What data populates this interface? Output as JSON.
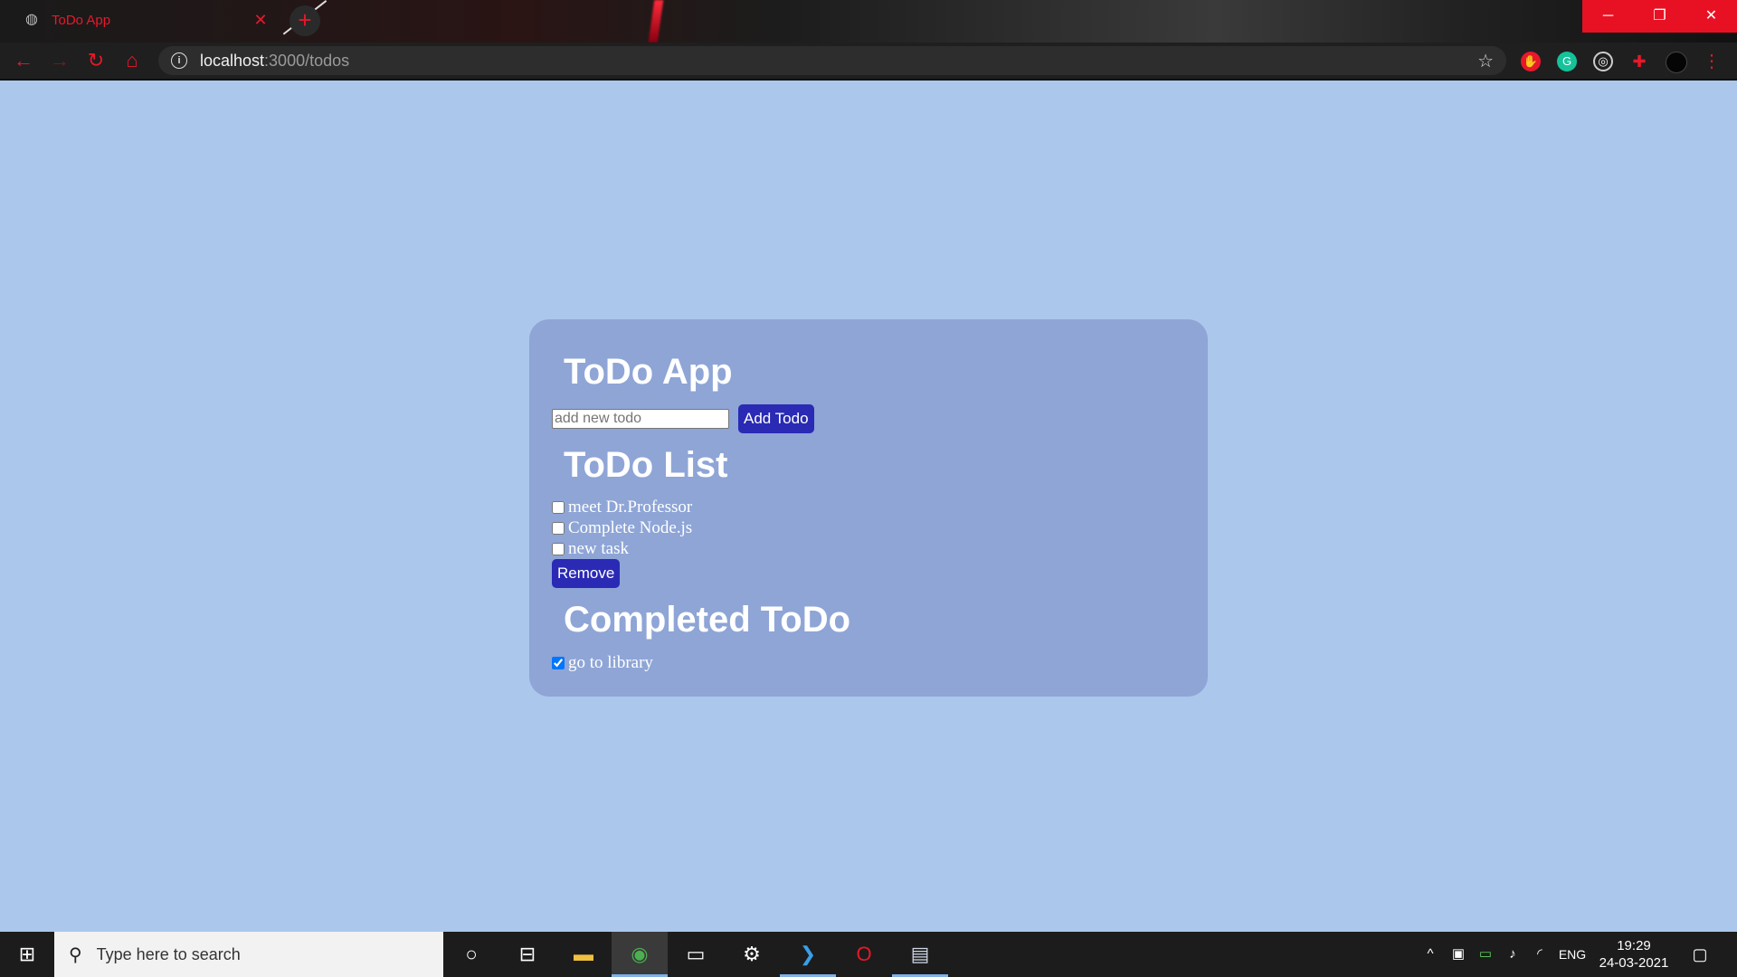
{
  "browser": {
    "tab_title": "ToDo App",
    "tab_close": "✕",
    "new_tab": "+",
    "url_host": "localhost",
    "url_path": ":3000/todos",
    "window_controls": {
      "minimize": "─",
      "restore": "❐",
      "close": "✕"
    }
  },
  "app": {
    "title": "ToDo App",
    "input_placeholder": "add new todo",
    "add_button": "Add Todo",
    "list_heading": "ToDo List",
    "todos": [
      {
        "label": "meet Dr.Professor",
        "checked": false
      },
      {
        "label": "Complete Node.js",
        "checked": false
      },
      {
        "label": "new task",
        "checked": false
      }
    ],
    "remove_button": "Remove",
    "completed_heading": "Completed ToDo",
    "completed": [
      {
        "label": "go to library",
        "checked": true
      }
    ]
  },
  "taskbar": {
    "search_placeholder": "Type here to search",
    "language": "ENG",
    "time": "19:29",
    "date": "24-03-2021"
  },
  "colors": {
    "page_bg": "#abc7ec",
    "card_bg": "#8ea5d6",
    "button_bg": "#2a2ab5",
    "accent_red": "#e8182a"
  }
}
